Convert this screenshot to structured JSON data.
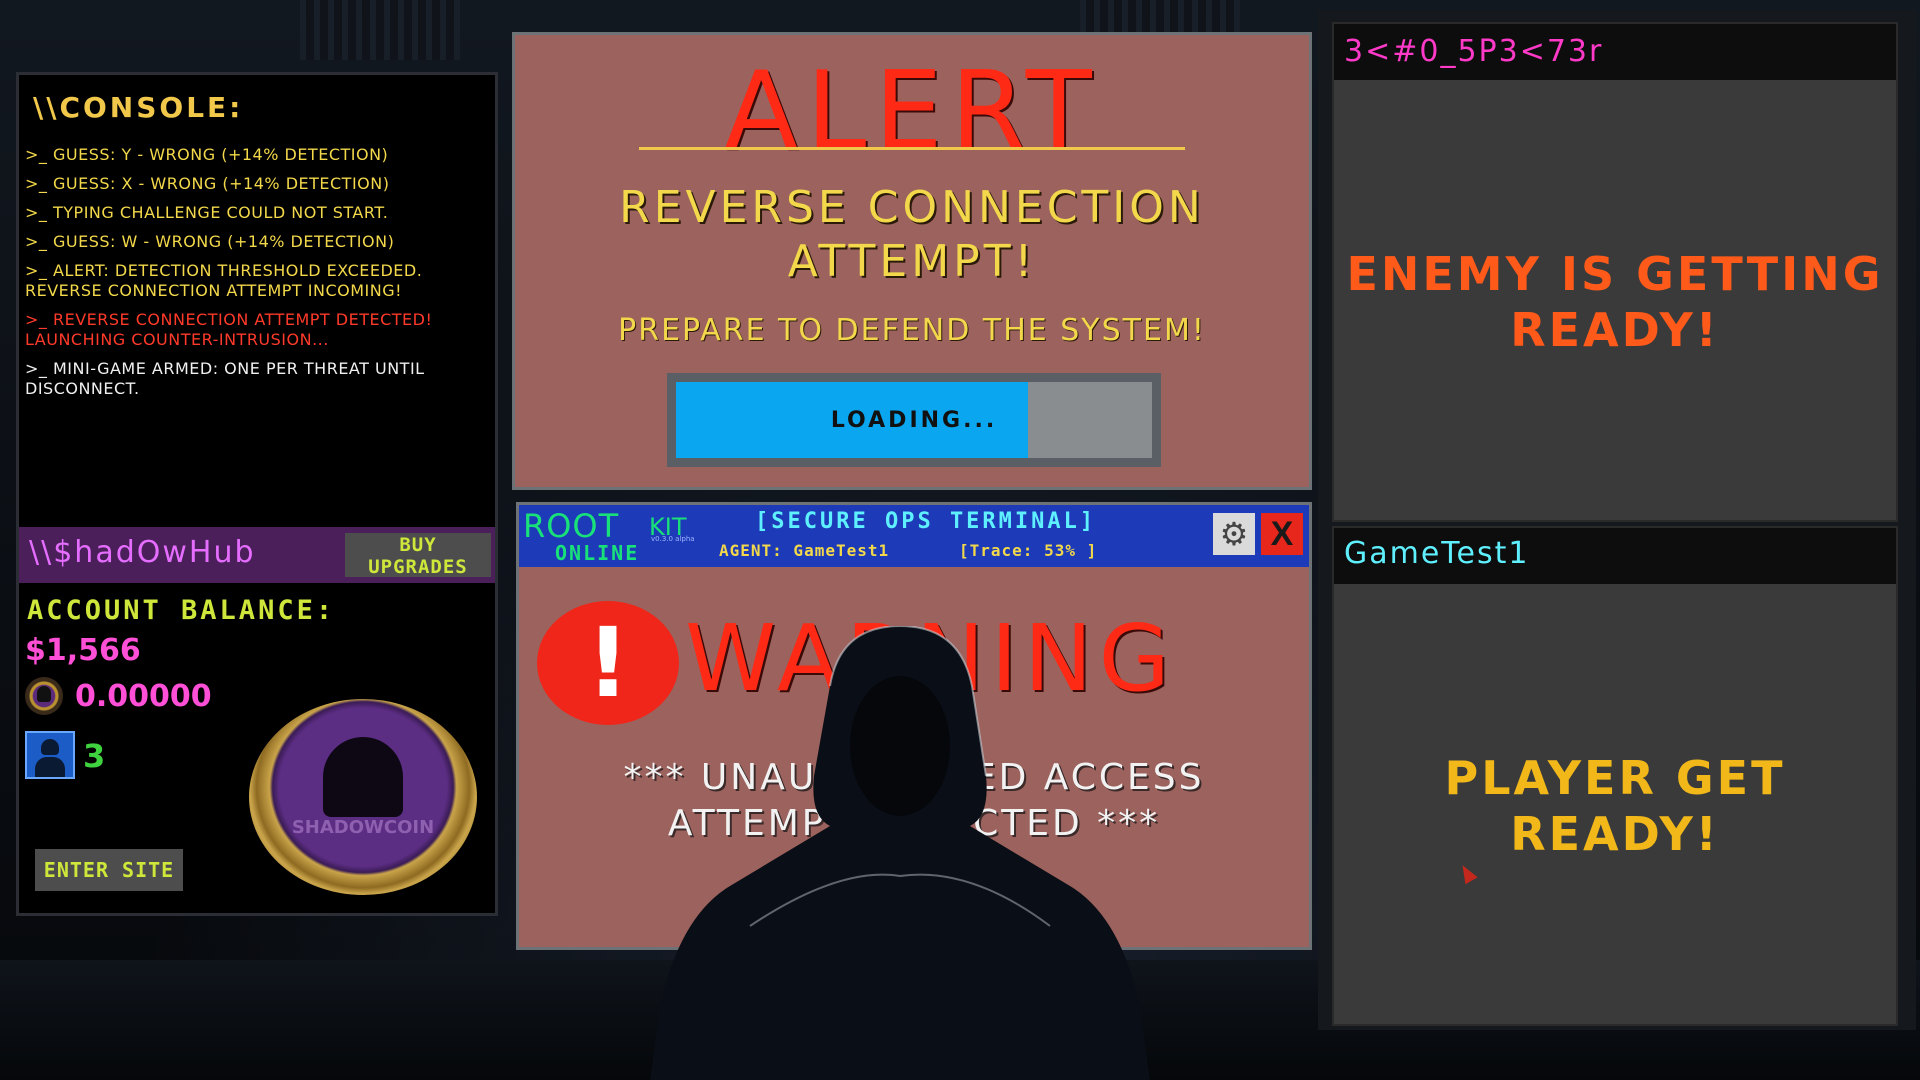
{
  "console": {
    "title": "\\\\CONSOLE:",
    "lines": [
      {
        "text": ">_ GUESS: Y - WRONG (+14% DETECTION)",
        "color": "#f2d84a"
      },
      {
        "text": ">_ GUESS: X - WRONG (+14% DETECTION)",
        "color": "#f2d84a"
      },
      {
        "text": ">_ TYPING CHALLENGE COULD NOT START.",
        "color": "#f2d84a"
      },
      {
        "text": ">_ GUESS: W - WRONG (+14% DETECTION)",
        "color": "#f2d84a"
      },
      {
        "text": ">_ ALERT: DETECTION THRESHOLD EXCEEDED. REVERSE CONNECTION ATTEMPT INCOMING!",
        "color": "#f2d84a"
      },
      {
        "text": ">_ REVERSE CONNECTION ATTEMPT DETECTED! LAUNCHING COUNTER-INTRUSION...",
        "color": "#ff3a2a"
      },
      {
        "text": ">_ MINI-GAME ARMED: ONE PER THREAT UNTIL DISCONNECT.",
        "color": "#f0f0f0"
      }
    ]
  },
  "shadowhub": {
    "title": "\\\\$hadOwHub",
    "buy_upgrades_label": "BUY UPGRADES",
    "balance_label": "ACCOUNT BALANCE:",
    "balance_value": "$1,566",
    "coin_value": "0.00000",
    "agent_count": "3",
    "enter_site_label": "ENTER SITE",
    "coin_label": "SHADOWCOIN"
  },
  "alert": {
    "title": "ALERT",
    "headline": "REVERSE CONNECTION ATTEMPT!",
    "subline": "PREPARE TO DEFEND THE SYSTEM!",
    "loading_text": "LOADING...",
    "loading_progress": 0.74
  },
  "terminal": {
    "brand_root": "ROOT",
    "brand_kit": "KIT",
    "brand_version": "v0.3.0 alpha",
    "status": "ONLINE",
    "title": "[SECURE OPS TERMINAL]",
    "agent": "AGENT: GameTest1",
    "trace": "[Trace: 53% ]",
    "close_label": "X",
    "warning_mark": "!",
    "warning_text": "WARNING",
    "unauthorized_text": "*** UNAUTHORIZED ACCESS ATTEMPT DETECTED ***"
  },
  "enemy": {
    "name": "3<#0_5P3<73r",
    "status": "ENEMY IS GETTING READY!"
  },
  "player": {
    "name": "GameTest1",
    "status": "PLAYER GET READY!"
  },
  "icons": {
    "settings": "gear-icon",
    "close": "close-icon",
    "warning": "exclamation-icon",
    "coin": "shadowcoin-icon",
    "agent": "hooded-agent-icon"
  }
}
